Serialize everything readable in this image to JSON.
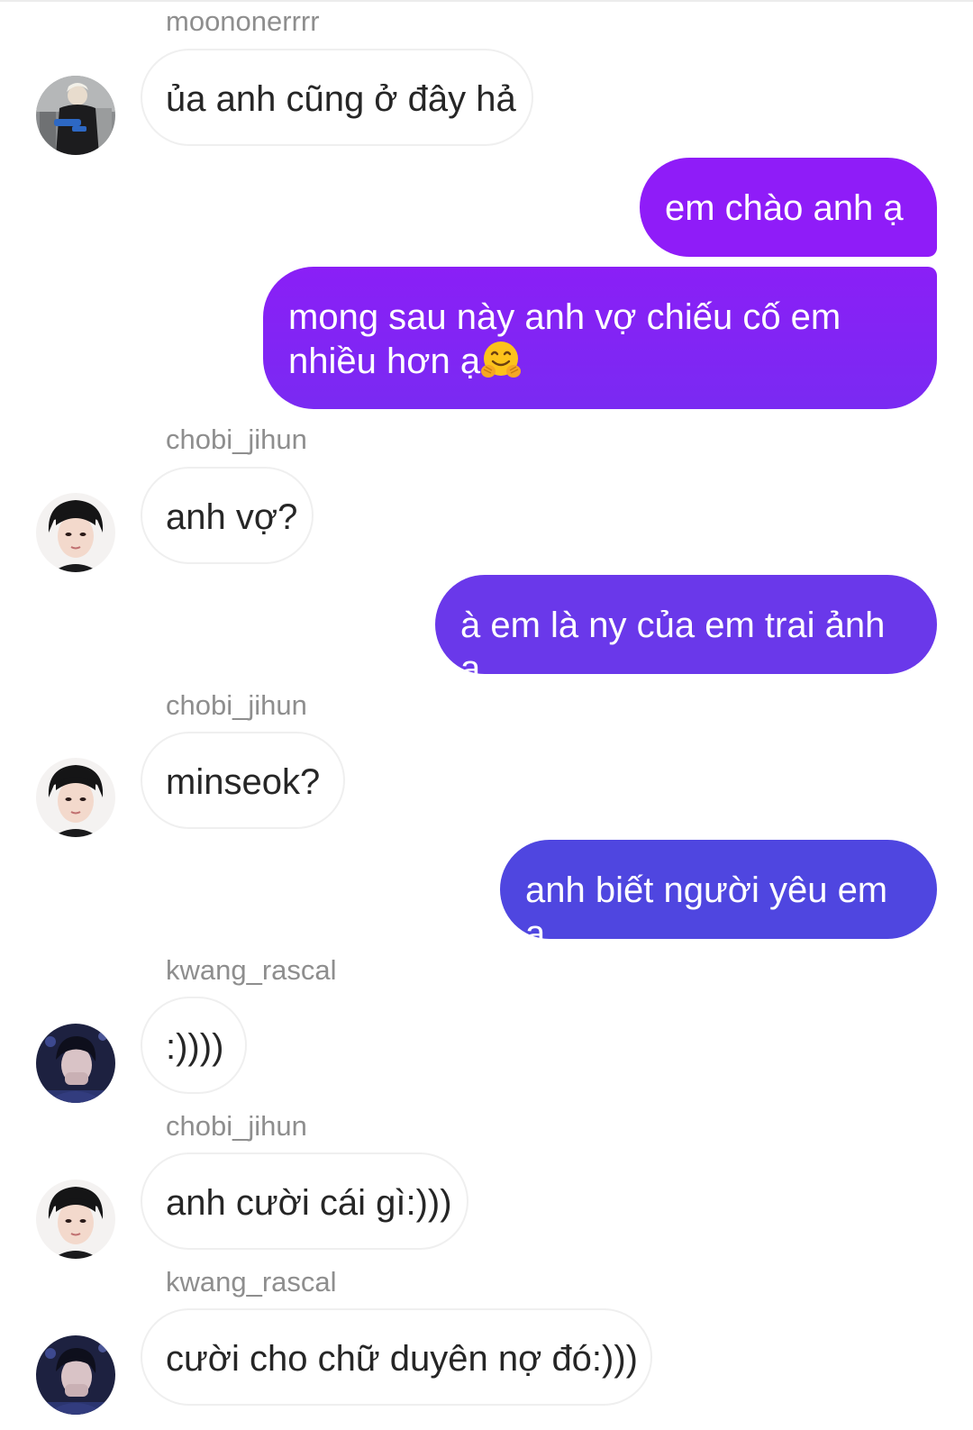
{
  "thread": {
    "messages": [
      {
        "sender": "moononerrrr",
        "text": "ủa anh cũng ở đây hả",
        "direction": "incoming",
        "avatar": "avatar-moononerrrr"
      },
      {
        "text": "em chào anh ạ",
        "direction": "outgoing"
      },
      {
        "text": "mong sau này anh vợ chiếu cố em nhiều hơn ạ",
        "direction": "outgoing",
        "emoji": "hugging-face-emoji"
      },
      {
        "sender": "chobi_jihun",
        "text": "anh vợ?",
        "direction": "incoming",
        "avatar": "avatar-chobi-jihun"
      },
      {
        "text": "à em là ny của em trai ảnh ạ",
        "direction": "outgoing"
      },
      {
        "sender": "chobi_jihun",
        "text": "minseok?",
        "direction": "incoming",
        "avatar": "avatar-chobi-jihun"
      },
      {
        "text": "anh biết người yêu em ạ",
        "direction": "outgoing"
      },
      {
        "sender": "kwang_rascal",
        "text": ":))))",
        "direction": "incoming",
        "avatar": "avatar-kwang-rascal"
      },
      {
        "sender": "chobi_jihun",
        "text": "anh cười cái gì:)))",
        "direction": "incoming",
        "avatar": "avatar-chobi-jihun"
      },
      {
        "sender": "kwang_rascal",
        "text": "cười cho chữ duyên nợ đó:)))",
        "direction": "incoming",
        "avatar": "avatar-kwang-rascal"
      }
    ]
  },
  "colors": {
    "outgoing_gradient": [
      "#8f1cf8",
      "#7a2af2",
      "#6a38ea",
      "#4f46e0"
    ],
    "incoming_border": "#efefef",
    "username_text": "#8e8e8e",
    "message_text": "#262626"
  }
}
